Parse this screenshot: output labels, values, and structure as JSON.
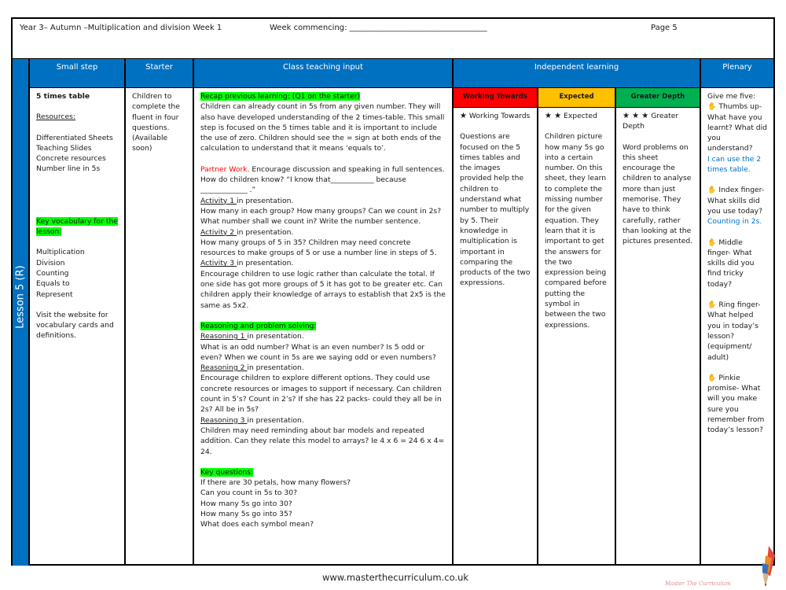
{
  "header": {
    "title": "Year 3– Autumn –Multiplication and division Week 1",
    "week_commencing": "Week commencing: ___________________________________",
    "page": "Page 5"
  },
  "columns": {
    "lesson": "Lesson 5 (R)",
    "small_step": "Small step",
    "starter": "Starter",
    "class_teaching": "Class teaching input",
    "independent": "Independent learning",
    "plenary": "Plenary"
  },
  "small_step": {
    "title": "5 times table",
    "resources_label": "Resources:",
    "resources": [
      "Differentiated Sheets",
      "Teaching Slides",
      "Concrete resources",
      "Number line in 5s"
    ],
    "vocab_label": "Key vocabulary for the lesson:",
    "vocab": [
      "Multiplication",
      "Division",
      "Counting",
      "Equals to",
      "Represent"
    ],
    "visit": "Visit the website for vocabulary cards and definitions."
  },
  "starter": {
    "text": "Children to complete the fluent in four questions. (Available soon)"
  },
  "class_teaching": {
    "recap_label": "Recap previous learning: (Q1 on the starter)",
    "recap_text": "Children can already count in 5s from any given number. They will also have developed understanding of the 2 times-table. This small step is focused on the 5 times table and it is important to include the use of zero. Children should see the = sign at both ends of the calculation to understand that it means ‘equals to’.",
    "partner_label": "Partner Work.",
    "partner_text": " Encourage discussion and speaking in full sentences. How do children know?  “I know that____________ because _____________ .”",
    "activities": [
      {
        "label": "Activity 1 ",
        "suffix": "in presentation.",
        "text": "How many in each group? How many groups? Can we count in 2s? What number shall we count in? Write the number sentence."
      },
      {
        "label": "Activity 2 ",
        "suffix": "in presentation.",
        "text": "How many groups of 5 in 35? Children may need concrete resources to make groups of 5 or use a number line in steps of 5."
      },
      {
        "label": "Activity 3 ",
        "suffix": "in presentation.",
        "text": "Encourage children to use logic rather than calculate the total. If one side has got more groups of 5 it has got to be greater etc. Can children apply their knowledge of arrays to establish that 2x5 is the same as 5x2."
      }
    ],
    "reasoning_label": "Reasoning and problem solving:",
    "reasoning": [
      {
        "label": "Reasoning 1 ",
        "suffix": "in presentation.",
        "text": "What is an odd number? What is an even number? Is 5 odd or even? When we count in 5s are we saying odd or even numbers?"
      },
      {
        "label": "Reasoning 2 ",
        "suffix": "in presentation.",
        "text": "Encourage children to explore different options. They could use concrete resources or images to support if necessary. Can children count in 5’s? Count in 2’s? If she has 22 packs- could they all be in 2s? All be in 5s?"
      },
      {
        "label": "Reasoning 3 ",
        "suffix": "in presentation.",
        "text": "Children may need reminding about bar models and repeated addition. Can they relate this model to arrays?  Ie 4 x 6 = 24 6 x 4= 24."
      }
    ],
    "key_questions_label": "Key questions:",
    "key_questions": [
      "If there are 30 petals, how many flowers?",
      "Can you count in 5s to 30?",
      "How many 5s go into 30?",
      "How many 5s go into 35?",
      "What does each symbol mean?"
    ]
  },
  "independent": {
    "working_towards": {
      "band": "Working Towards",
      "stars": "★",
      "title": "Working Towards",
      "text": "Questions are focused on the 5 times tables and the images provided help the children to understand what number to multiply by 5. Their knowledge in multiplication is important in comparing the products of the two expressions.",
      "color": "#ff0000"
    },
    "expected": {
      "band": "Expected",
      "stars": "★ ★",
      "title": "Expected",
      "text": "Children picture how many 5s go into a certain number. On this sheet, they learn to complete the missing number for the given equation. They learn that it is important to get the answers for the two expression being compared before putting the symbol in between the two expressions.",
      "color": "#ffc000"
    },
    "greater_depth": {
      "band": "Greater Depth",
      "stars": "★ ★ ★",
      "title": "Greater Depth",
      "text": "Word problems on this sheet encourage the children to analyse more than just memorise. They have to think carefully, rather than looking at the pictures presented.",
      "color": "#00b050"
    }
  },
  "plenary": {
    "intro": "Give me five:",
    "icon": "✋",
    "items": [
      {
        "text": " Thumbs up- What have you learnt? What did you understand?",
        "answer": "I can use the 2 times table."
      },
      {
        "text": " Index finger- What skills did you use today?",
        "answer": "Counting in 2s."
      },
      {
        "text": " Middle finger- What skills did you find tricky today?",
        "answer": ""
      },
      {
        "text": " Ring finger- What helped you in today’s lesson? (equipment/ adult)",
        "answer": ""
      },
      {
        "text": " Pinkie promise- What will you make sure you remember from today’s lesson?",
        "answer": ""
      }
    ]
  },
  "footer": {
    "url": "www.masterthecurriculum.co.uk",
    "logo_text": "Master The Curriculum"
  },
  "colors": {
    "header_blue": "#0070c0",
    "highlight_green": "#00ff00",
    "partner_red": "#ff0000",
    "answer_blue": "#0070c0"
  }
}
